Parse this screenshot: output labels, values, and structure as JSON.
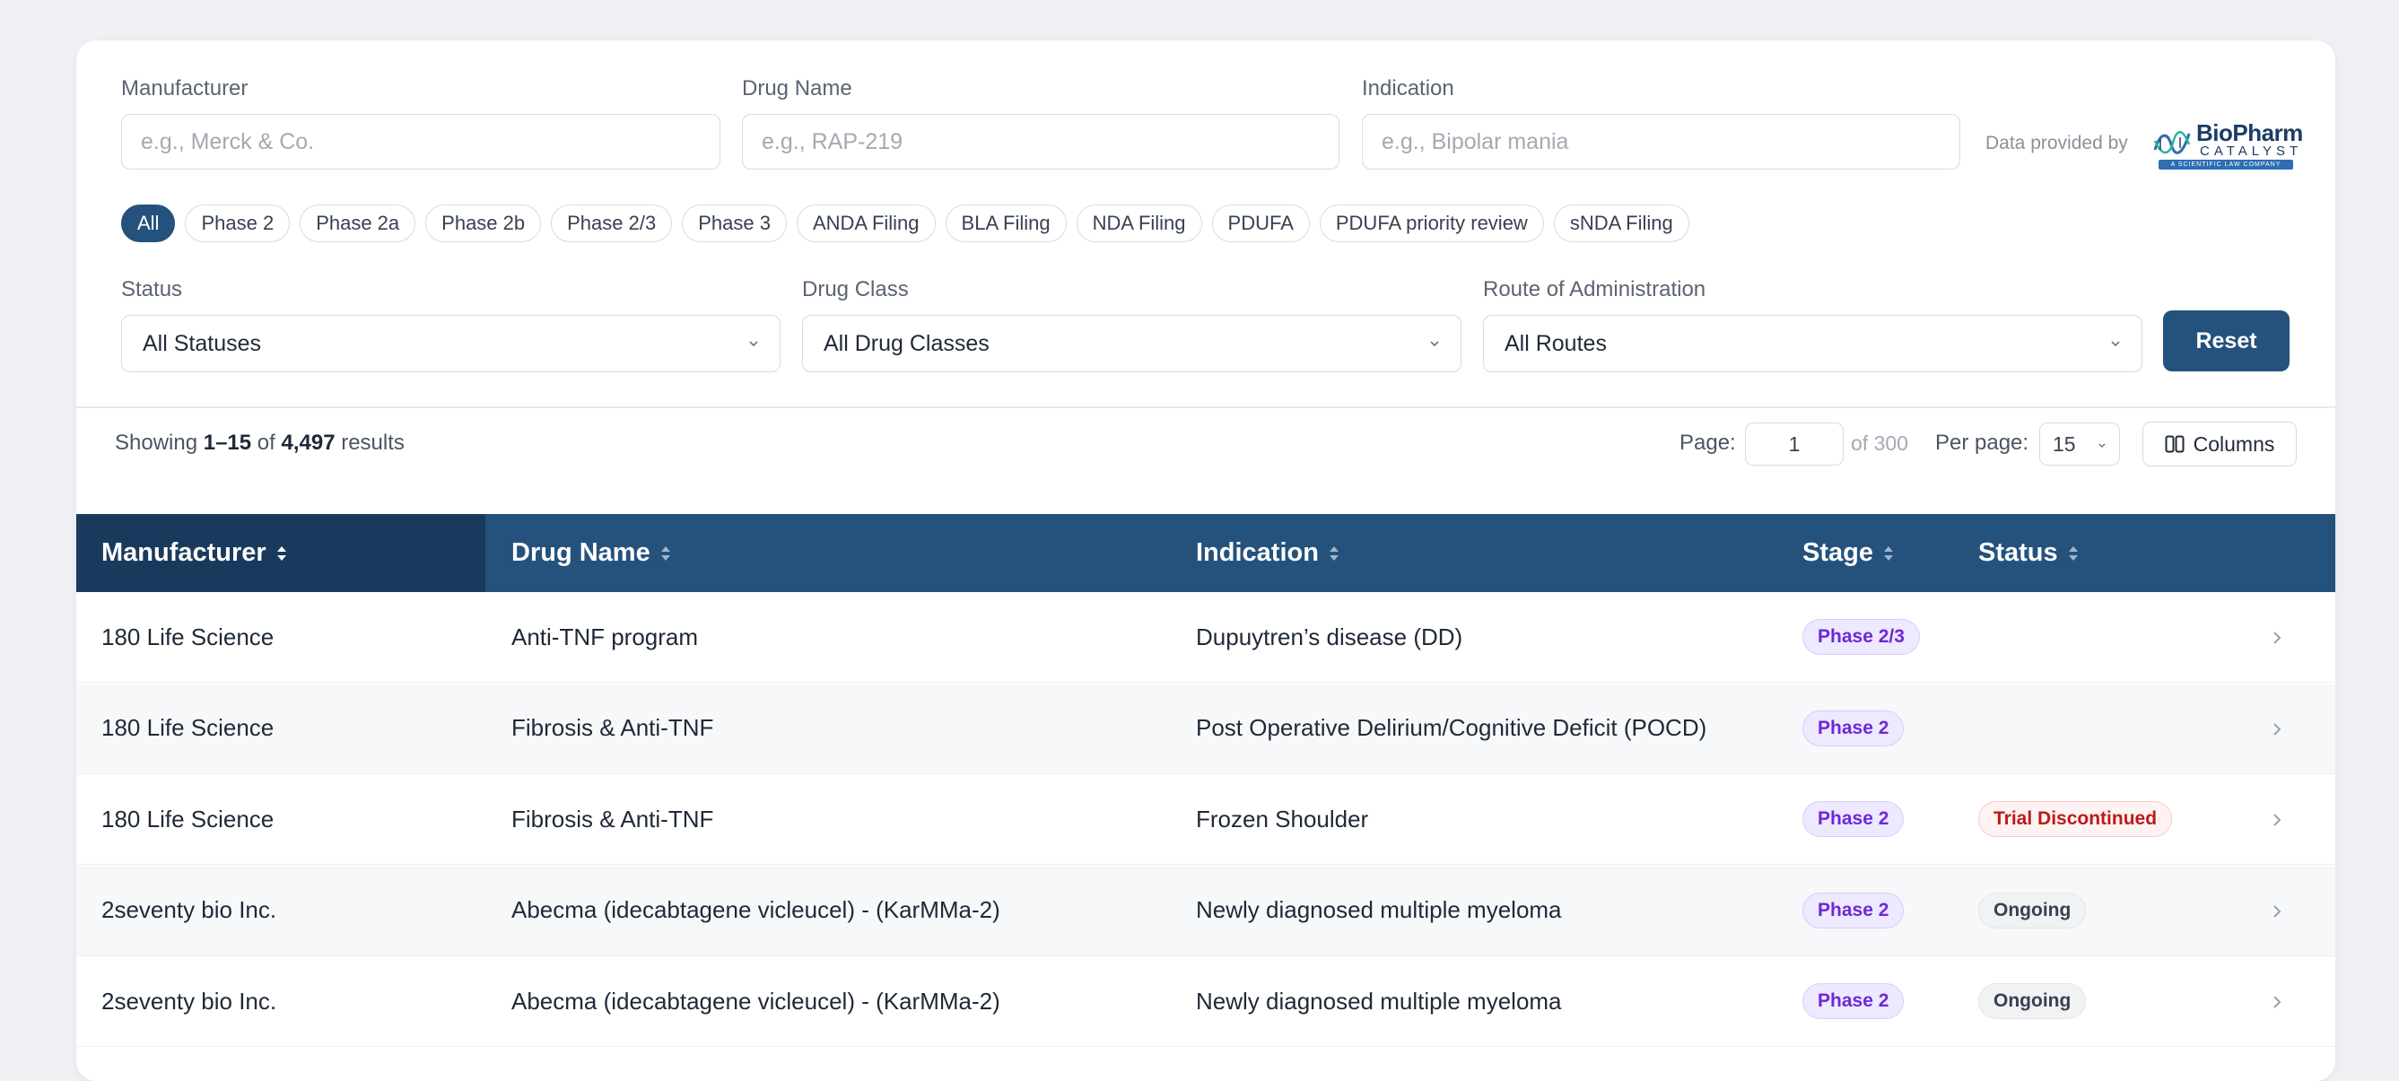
{
  "filters": {
    "manufacturer": {
      "label": "Manufacturer",
      "placeholder": "e.g., Merck & Co."
    },
    "drug_name": {
      "label": "Drug Name",
      "placeholder": "e.g., RAP-219"
    },
    "indication": {
      "label": "Indication",
      "placeholder": "e.g., Bipolar mania"
    },
    "provided_by": "Data provided by",
    "logo": {
      "name": "BioPharm",
      "sub": "CATALYST",
      "tagline": "A SCIENTIFIC LAW COMPANY"
    },
    "stage_chips": [
      "All",
      "Phase 2",
      "Phase 2a",
      "Phase 2b",
      "Phase 2/3",
      "Phase 3",
      "ANDA Filing",
      "BLA Filing",
      "NDA Filing",
      "PDUFA",
      "PDUFA priority review",
      "sNDA Filing"
    ],
    "active_chip": "All",
    "status": {
      "label": "Status",
      "value": "All Statuses"
    },
    "drug_class": {
      "label": "Drug Class",
      "value": "All Drug Classes"
    },
    "route": {
      "label": "Route of Administration",
      "value": "All Routes"
    },
    "reset_label": "Reset"
  },
  "results": {
    "prefix": "Showing",
    "range": "1–15",
    "of_word": "of",
    "total": "4,497",
    "suffix": "results",
    "page_label": "Page:",
    "page_value": "1",
    "page_of": "of 300",
    "per_page_label": "Per page:",
    "per_page_value": "15",
    "columns_label": "Columns"
  },
  "table": {
    "headers": [
      "Manufacturer",
      "Drug Name",
      "Indication",
      "Stage",
      "Status"
    ],
    "rows": [
      {
        "manufacturer": "180 Life Science",
        "drug": "Anti-TNF program",
        "indication": "Dupuytren’s disease (DD)",
        "stage": "Phase 2/3",
        "status": ""
      },
      {
        "manufacturer": "180 Life Science",
        "drug": "Fibrosis & Anti-TNF",
        "indication": "Post Operative Delirium/Cognitive Deficit (POCD)",
        "stage": "Phase 2",
        "status": ""
      },
      {
        "manufacturer": "180 Life Science",
        "drug": "Fibrosis & Anti-TNF",
        "indication": "Frozen Shoulder",
        "stage": "Phase 2",
        "status": "Trial Discontinued"
      },
      {
        "manufacturer": "2seventy bio Inc.",
        "drug": "Abecma (idecabtagene vicleucel) - (KarMMa-2)",
        "indication": "Newly diagnosed multiple myeloma",
        "stage": "Phase 2",
        "status": "Ongoing"
      },
      {
        "manufacturer": "2seventy bio Inc.",
        "drug": "Abecma (idecabtagene vicleucel) - (KarMMa-2)",
        "indication": "Newly diagnosed multiple myeloma",
        "stage": "Phase 2",
        "status": "Ongoing"
      }
    ]
  },
  "colors": {
    "primary": "#24527d",
    "header_dark": "#193a5c",
    "phase_badge": "#6d28d9",
    "discontinued": "#b91c1c"
  }
}
